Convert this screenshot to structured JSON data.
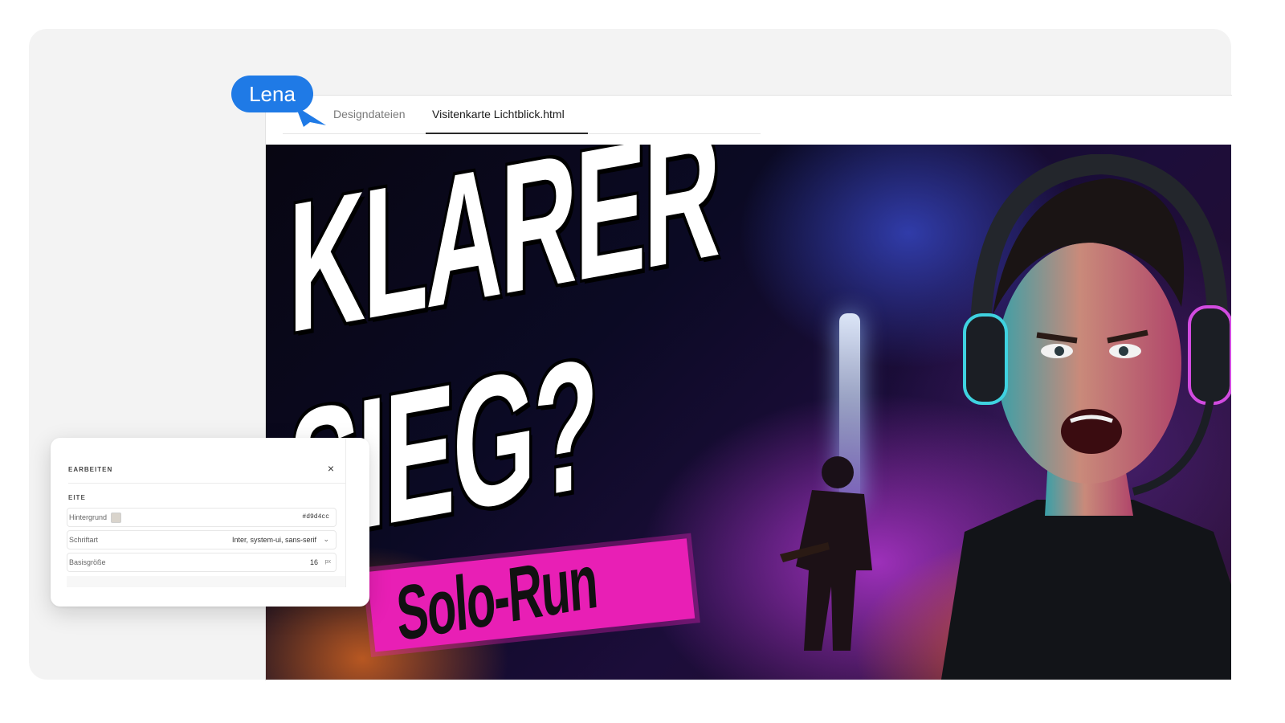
{
  "cursor": {
    "user": "Lena",
    "color": "#1f7ae6"
  },
  "tabs": [
    {
      "label": "Designdateien",
      "active": false
    },
    {
      "label": "Visitenkarte Lichtblick.html",
      "active": true
    }
  ],
  "thumbnail": {
    "headline_line1": "KLARER",
    "headline_line2": "SIEG?",
    "tagline": "Solo-Run",
    "tagline_bg": "#e81fb5"
  },
  "edit_panel": {
    "title": "EARBEITEN",
    "close": "×",
    "section": "EITE",
    "background": {
      "label": "Hintergrund",
      "value": "#d9d4cc",
      "swatch": "#d9d4cc"
    },
    "font": {
      "label": "Schriftart",
      "value": "Inter, system-ui, sans-serif",
      "chevron": "⌄"
    },
    "base_size": {
      "label": "Basisgröße",
      "value": "16",
      "unit": "px"
    }
  }
}
